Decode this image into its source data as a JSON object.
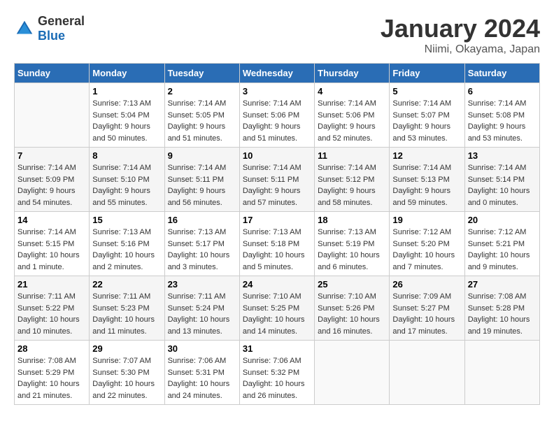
{
  "header": {
    "logo_general": "General",
    "logo_blue": "Blue",
    "month_title": "January 2024",
    "subtitle": "Niimi, Okayama, Japan"
  },
  "weekdays": [
    "Sunday",
    "Monday",
    "Tuesday",
    "Wednesday",
    "Thursday",
    "Friday",
    "Saturday"
  ],
  "weeks": [
    [
      {
        "day": "",
        "info": ""
      },
      {
        "day": "1",
        "info": "Sunrise: 7:13 AM\nSunset: 5:04 PM\nDaylight: 9 hours\nand 50 minutes."
      },
      {
        "day": "2",
        "info": "Sunrise: 7:14 AM\nSunset: 5:05 PM\nDaylight: 9 hours\nand 51 minutes."
      },
      {
        "day": "3",
        "info": "Sunrise: 7:14 AM\nSunset: 5:06 PM\nDaylight: 9 hours\nand 51 minutes."
      },
      {
        "day": "4",
        "info": "Sunrise: 7:14 AM\nSunset: 5:06 PM\nDaylight: 9 hours\nand 52 minutes."
      },
      {
        "day": "5",
        "info": "Sunrise: 7:14 AM\nSunset: 5:07 PM\nDaylight: 9 hours\nand 53 minutes."
      },
      {
        "day": "6",
        "info": "Sunrise: 7:14 AM\nSunset: 5:08 PM\nDaylight: 9 hours\nand 53 minutes."
      }
    ],
    [
      {
        "day": "7",
        "info": "Sunrise: 7:14 AM\nSunset: 5:09 PM\nDaylight: 9 hours\nand 54 minutes."
      },
      {
        "day": "8",
        "info": "Sunrise: 7:14 AM\nSunset: 5:10 PM\nDaylight: 9 hours\nand 55 minutes."
      },
      {
        "day": "9",
        "info": "Sunrise: 7:14 AM\nSunset: 5:11 PM\nDaylight: 9 hours\nand 56 minutes."
      },
      {
        "day": "10",
        "info": "Sunrise: 7:14 AM\nSunset: 5:11 PM\nDaylight: 9 hours\nand 57 minutes."
      },
      {
        "day": "11",
        "info": "Sunrise: 7:14 AM\nSunset: 5:12 PM\nDaylight: 9 hours\nand 58 minutes."
      },
      {
        "day": "12",
        "info": "Sunrise: 7:14 AM\nSunset: 5:13 PM\nDaylight: 9 hours\nand 59 minutes."
      },
      {
        "day": "13",
        "info": "Sunrise: 7:14 AM\nSunset: 5:14 PM\nDaylight: 10 hours\nand 0 minutes."
      }
    ],
    [
      {
        "day": "14",
        "info": "Sunrise: 7:14 AM\nSunset: 5:15 PM\nDaylight: 10 hours\nand 1 minute."
      },
      {
        "day": "15",
        "info": "Sunrise: 7:13 AM\nSunset: 5:16 PM\nDaylight: 10 hours\nand 2 minutes."
      },
      {
        "day": "16",
        "info": "Sunrise: 7:13 AM\nSunset: 5:17 PM\nDaylight: 10 hours\nand 3 minutes."
      },
      {
        "day": "17",
        "info": "Sunrise: 7:13 AM\nSunset: 5:18 PM\nDaylight: 10 hours\nand 5 minutes."
      },
      {
        "day": "18",
        "info": "Sunrise: 7:13 AM\nSunset: 5:19 PM\nDaylight: 10 hours\nand 6 minutes."
      },
      {
        "day": "19",
        "info": "Sunrise: 7:12 AM\nSunset: 5:20 PM\nDaylight: 10 hours\nand 7 minutes."
      },
      {
        "day": "20",
        "info": "Sunrise: 7:12 AM\nSunset: 5:21 PM\nDaylight: 10 hours\nand 9 minutes."
      }
    ],
    [
      {
        "day": "21",
        "info": "Sunrise: 7:11 AM\nSunset: 5:22 PM\nDaylight: 10 hours\nand 10 minutes."
      },
      {
        "day": "22",
        "info": "Sunrise: 7:11 AM\nSunset: 5:23 PM\nDaylight: 10 hours\nand 11 minutes."
      },
      {
        "day": "23",
        "info": "Sunrise: 7:11 AM\nSunset: 5:24 PM\nDaylight: 10 hours\nand 13 minutes."
      },
      {
        "day": "24",
        "info": "Sunrise: 7:10 AM\nSunset: 5:25 PM\nDaylight: 10 hours\nand 14 minutes."
      },
      {
        "day": "25",
        "info": "Sunrise: 7:10 AM\nSunset: 5:26 PM\nDaylight: 10 hours\nand 16 minutes."
      },
      {
        "day": "26",
        "info": "Sunrise: 7:09 AM\nSunset: 5:27 PM\nDaylight: 10 hours\nand 17 minutes."
      },
      {
        "day": "27",
        "info": "Sunrise: 7:08 AM\nSunset: 5:28 PM\nDaylight: 10 hours\nand 19 minutes."
      }
    ],
    [
      {
        "day": "28",
        "info": "Sunrise: 7:08 AM\nSunset: 5:29 PM\nDaylight: 10 hours\nand 21 minutes."
      },
      {
        "day": "29",
        "info": "Sunrise: 7:07 AM\nSunset: 5:30 PM\nDaylight: 10 hours\nand 22 minutes."
      },
      {
        "day": "30",
        "info": "Sunrise: 7:06 AM\nSunset: 5:31 PM\nDaylight: 10 hours\nand 24 minutes."
      },
      {
        "day": "31",
        "info": "Sunrise: 7:06 AM\nSunset: 5:32 PM\nDaylight: 10 hours\nand 26 minutes."
      },
      {
        "day": "",
        "info": ""
      },
      {
        "day": "",
        "info": ""
      },
      {
        "day": "",
        "info": ""
      }
    ]
  ]
}
